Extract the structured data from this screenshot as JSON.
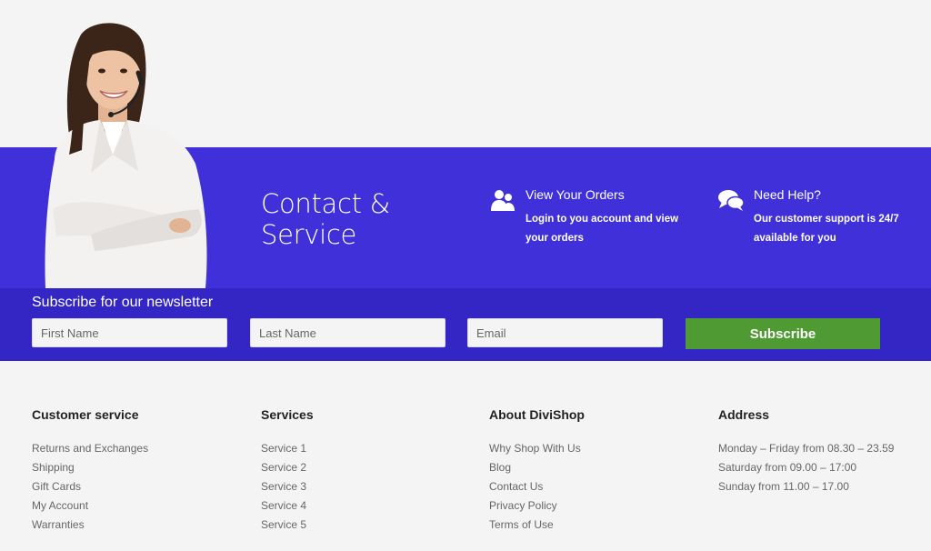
{
  "contact": {
    "title_line1": "Contact &",
    "title_line2": "Service"
  },
  "features": [
    {
      "icon": "users-icon",
      "title": "View Your Orders",
      "desc": "Login to you account and view your orders"
    },
    {
      "icon": "chat-bubbles-icon",
      "title": "Need Help?",
      "desc": "Our customer support is 24/7 available for you"
    }
  ],
  "newsletter": {
    "title": "Subscribe for our newsletter",
    "first_name_placeholder": "First Name",
    "last_name_placeholder": "Last Name",
    "email_placeholder": "Email",
    "button": "Subscribe"
  },
  "footer": {
    "columns": [
      {
        "title": "Customer service",
        "items": [
          "Returns and Exchanges",
          "Shipping",
          "Gift Cards",
          "My Account",
          "Warranties"
        ]
      },
      {
        "title": "Services",
        "items": [
          "Service 1",
          "Service 2",
          "Service 3",
          "Service 4",
          "Service 5"
        ]
      },
      {
        "title": "About DiviShop",
        "items": [
          "Why Shop With Us",
          "Blog",
          "Contact Us",
          "Privacy Policy",
          "Terms of Use"
        ]
      },
      {
        "title": "Address",
        "items": [
          "Monday – Friday from 08.30 – 23.59",
          "Saturday from 09.00 – 17:00",
          "Sunday from 11.00 – 17.00"
        ]
      }
    ]
  },
  "colors": {
    "band": "#4030da",
    "newsletter_band": "#3426c4",
    "subscribe_button": "#4f9a32",
    "background": "#f5f4f5"
  }
}
